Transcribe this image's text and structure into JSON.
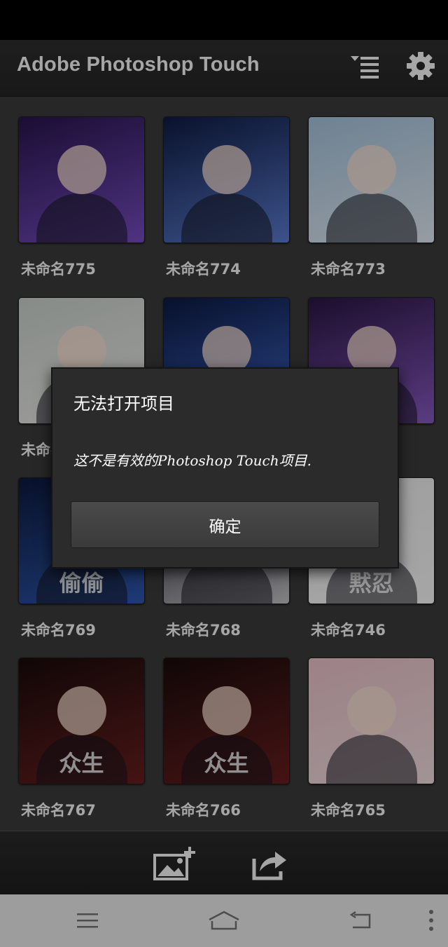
{
  "app": {
    "title": "Adobe Photoshop Touch"
  },
  "header": {
    "sort_icon": "list-sort-icon",
    "settings_icon": "gear-icon"
  },
  "projects": [
    {
      "name": "未命名775",
      "colors": [
        "#2a1550",
        "#7a4fc7"
      ],
      "caption": ""
    },
    {
      "name": "未命名774",
      "colors": [
        "#0f1c45",
        "#5c7fd6"
      ],
      "caption": ""
    },
    {
      "name": "未命名773",
      "colors": [
        "#a9c8e3",
        "#e7f0f8"
      ],
      "caption": ""
    },
    {
      "name": "未命名...",
      "colors": [
        "#cfd7d2",
        "#f3f1ee"
      ],
      "caption": ""
    },
    {
      "name": "",
      "colors": [
        "#0d1a44",
        "#3f6bd0"
      ],
      "caption": ""
    },
    {
      "name": "",
      "colors": [
        "#2c1645",
        "#8c5cc8"
      ],
      "caption": ""
    },
    {
      "name": "未命名769",
      "colors": [
        "#0c1a40",
        "#2f5bb5"
      ],
      "caption": "偷偷"
    },
    {
      "name": "未命名768",
      "colors": [
        "#20202a",
        "#c8c8cc"
      ],
      "caption": ""
    },
    {
      "name": "未命名746",
      "colors": [
        "#f3f3f3",
        "#ffffff"
      ],
      "caption": "黙忍"
    },
    {
      "name": "未命名767",
      "colors": [
        "#1a0b0b",
        "#6b1f1f"
      ],
      "caption": "众生"
    },
    {
      "name": "未命名766",
      "colors": [
        "#1a0b0b",
        "#6b1f1f"
      ],
      "caption": "众生"
    },
    {
      "name": "未命名765",
      "colors": [
        "#f2c7cf",
        "#f7e3e6"
      ],
      "caption": ""
    }
  ],
  "toolbar": {
    "new_project_icon": "add-image-icon",
    "share_icon": "share-icon"
  },
  "dialog": {
    "title": "无法打开项目",
    "message": "这不是有效的Photoshop Touch项目.",
    "ok_label": "确定"
  },
  "navbar": {
    "menu_icon": "menu-icon",
    "home_icon": "home-icon",
    "back_icon": "back-icon",
    "more_icon": "more-dots-icon"
  }
}
